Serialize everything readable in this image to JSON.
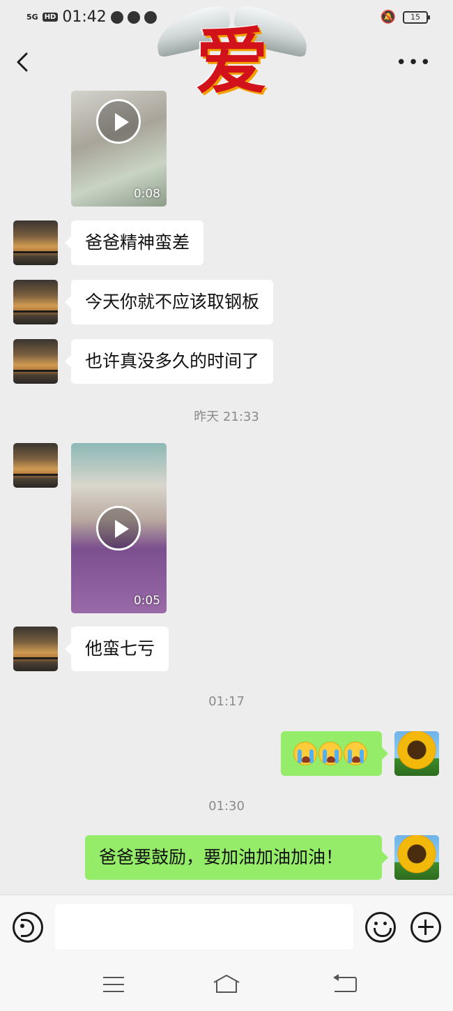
{
  "status_bar": {
    "network": "5G",
    "hd": "HD",
    "time": "01:42",
    "icons": [
      "message-icon",
      "alipay-icon",
      "app-icon",
      "app-icon"
    ],
    "battery": "15"
  },
  "header": {
    "logo_text": "爱",
    "back_icon": "chevron-left-icon",
    "more_icon": "more-dots-icon"
  },
  "messages": {
    "video1": {
      "duration": "0:08"
    },
    "text1": "爸爸精神蛮差",
    "text2": "今天你就不应该取钢板",
    "text3": "也许真没多久的时间了",
    "timestamp1": "昨天 21:33",
    "video2": {
      "duration": "0:05"
    },
    "text4": "他蛮七亏",
    "timestamp2": "01:17",
    "emoji_reply": "crying-face-emoji x3",
    "timestamp3": "01:30",
    "text5": "爸爸要鼓励，要加油加油加油！"
  },
  "input_bar": {
    "voice_icon": "voice-icon",
    "text_value": "",
    "emoji_icon": "emoji-icon",
    "plus_icon": "plus-icon"
  },
  "system_nav": {
    "menu_icon": "menu-icon",
    "home_icon": "home-icon",
    "back_icon": "back-icon"
  },
  "colors": {
    "background": "#ededed",
    "incoming_bubble": "#ffffff",
    "outgoing_bubble": "#95ec69",
    "timestamp_text": "#8a8a8a"
  }
}
